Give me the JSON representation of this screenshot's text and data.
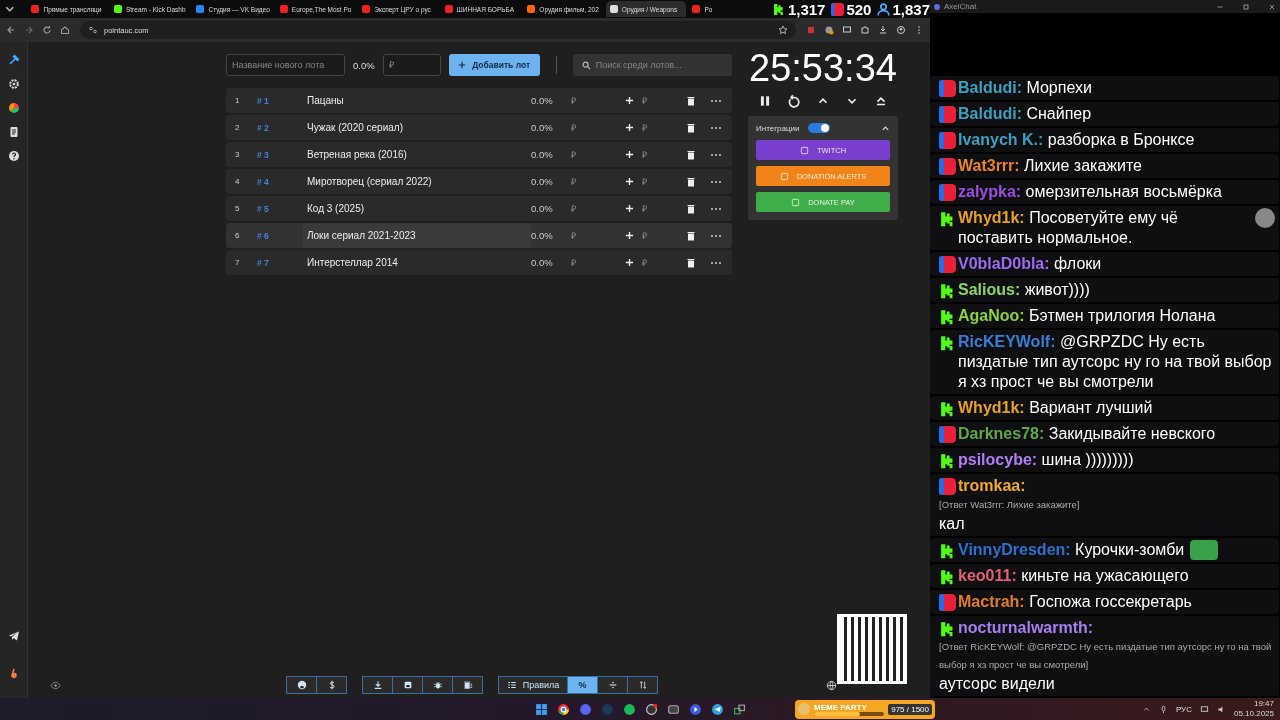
{
  "browser": {
    "tabs": [
      {
        "title": "Прямые трансляци",
        "kind": "youtube",
        "selected": false
      },
      {
        "title": "Stream - Kick Dashb",
        "kind": "kick",
        "selected": false
      },
      {
        "title": "Студия — VK Видео",
        "kind": "vk",
        "selected": false
      },
      {
        "title": "Europe,The Most Po",
        "kind": "youtube",
        "selected": false
      },
      {
        "title": "Эксперт ЦРУ о рус",
        "kind": "youtube",
        "selected": false
      },
      {
        "title": "ШИННАЯ БОРЬБА",
        "kind": "youtube",
        "selected": false
      },
      {
        "title": "Орудия фильм, 202",
        "kind": "kino",
        "selected": false
      },
      {
        "title": "Орудия / Weapons",
        "kind": "globe",
        "selected": true
      },
      {
        "title": "Po",
        "kind": "youtube",
        "selected": false
      }
    ],
    "address": "pointauc.com"
  },
  "stream_stats": [
    {
      "kind": "kick",
      "count": "1,317"
    },
    {
      "kind": "live",
      "count": "520"
    },
    {
      "kind": "viewers",
      "count": "1,837"
    }
  ],
  "auction": {
    "new_lot": {
      "placeholder": "Название нового лота"
    },
    "new_percent": "0.0%",
    "new_amount": {
      "placeholder": "₽"
    },
    "add_button": "Добавить лот",
    "search": {
      "placeholder": "Поиск среди лотов..."
    },
    "lots": [
      {
        "index": "1",
        "tag": "# 1",
        "name": "Пацаны",
        "percent": "0.0%",
        "amount": {
          "placeholder": "₽"
        },
        "add_amount": {
          "placeholder": "₽"
        },
        "highlighted": false
      },
      {
        "index": "2",
        "tag": "# 2",
        "name": "Чужак (2020 сериал)",
        "percent": "0.0%",
        "amount": {
          "placeholder": "₽"
        },
        "add_amount": {
          "placeholder": "₽"
        },
        "highlighted": false
      },
      {
        "index": "3",
        "tag": "# 3",
        "name": "Ветреная река (2016)",
        "percent": "0.0%",
        "amount": {
          "placeholder": "₽"
        },
        "add_amount": {
          "placeholder": "₽"
        },
        "highlighted": false
      },
      {
        "index": "4",
        "tag": "# 4",
        "name": "Миротворец (сериал 2022)",
        "percent": "0.0%",
        "amount": {
          "placeholder": "₽"
        },
        "add_amount": {
          "placeholder": "₽"
        },
        "highlighted": false
      },
      {
        "index": "5",
        "tag": "# 5",
        "name": "Код 3 (2025)",
        "percent": "0.0%",
        "amount": {
          "placeholder": "₽"
        },
        "add_amount": {
          "placeholder": "₽"
        },
        "highlighted": false
      },
      {
        "index": "6",
        "tag": "# 6",
        "name": "Локи сериал 2021-2023",
        "percent": "0.0%",
        "amount": {
          "placeholder": "₽"
        },
        "add_amount": {
          "placeholder": "₽"
        },
        "highlighted": true
      },
      {
        "index": "7",
        "tag": "# 7",
        "name": "Интерстеллар 2014",
        "percent": "0.0%",
        "amount": {
          "placeholder": "₽"
        },
        "add_amount": {
          "placeholder": "₽"
        },
        "highlighted": false
      }
    ],
    "timer": "25:53:34",
    "integrations": {
      "label": "Интеграции",
      "on": true,
      "expanded": true,
      "services": [
        {
          "label": "TWITCH",
          "color": "#7b3fd0"
        },
        {
          "label": "DONATION ALERTS",
          "color": "#f08418"
        },
        {
          "label": "DONATE PAY",
          "color": "#3fae4a"
        }
      ]
    },
    "toolbar": {
      "rules_button": "Правила",
      "percent_button": {
        "label": "%",
        "selected": true
      }
    }
  },
  "chat": {
    "title": "AxelChat",
    "messages": [
      {
        "kind": "live",
        "user": "Baldudi:",
        "color": "#3aa0c0",
        "text": "Морпехи"
      },
      {
        "kind": "live",
        "user": "Baldudi:",
        "color": "#3aa0c0",
        "text": "Снайпер"
      },
      {
        "kind": "live",
        "user": "Ivanych K.:",
        "color": "#3aa0c0",
        "text": "разборка в Бронксе"
      },
      {
        "kind": "live",
        "user": "Wat3rrr:",
        "color": "#e8832a",
        "text": "Лихие закажите"
      },
      {
        "kind": "live",
        "user": "zalypka:",
        "color": "#9b4de0",
        "text": "омерзительная восьмёрка"
      },
      {
        "kind": "kick",
        "user": "Whyd1k:",
        "color": "#e8a020",
        "text": "Посоветуйте ему чё поставить нормальное.",
        "emote": {
          "kind": "face"
        }
      },
      {
        "kind": "live",
        "user": "V0blaD0bla:",
        "color": "#9b6cf0",
        "text": "флоки"
      },
      {
        "kind": "kick",
        "user": "Salious:",
        "color": "#8ad46a",
        "text": "живот))))"
      },
      {
        "kind": "kick",
        "user": "AgaNoo:",
        "color": "#8ad040",
        "text": "Бэтмен трилогия Нолана"
      },
      {
        "kind": "kick",
        "user": "RicKEYWolf:",
        "color": "#3a7dd8",
        "text": "@GRPZDC Ну есть пиздатые тип аутсорс ну го на твой выбор я хз прост че вы смотрели"
      },
      {
        "kind": "kick",
        "user": "Whyd1k:",
        "color": "#e8a020",
        "text": "Вариант лучший"
      },
      {
        "kind": "live",
        "user": "Darknes78:",
        "color": "#5fa84a",
        "text": "Закидывайте невского"
      },
      {
        "kind": "kick",
        "user": "psilocybe:",
        "color": "#b07ef5",
        "text": "шина )))))))))"
      },
      {
        "kind": "live",
        "user": "tromkaa:",
        "color": "#f0a830",
        "reply": "[Ответ Wat3rrr: Лихие закажите]",
        "text": "кал"
      },
      {
        "kind": "kick",
        "user": "VinnyDresden:",
        "color": "#2f6fd0",
        "text": "Курочки-зомби",
        "emote": {
          "kind": "frog"
        }
      },
      {
        "kind": "kick",
        "user": "keo011:",
        "color": "#e06070",
        "text": "киньте на ужасающего"
      },
      {
        "kind": "live",
        "user": "Mactrah:",
        "color": "#e07a30",
        "text": "Госпожа госсекретарь"
      },
      {
        "kind": "kick",
        "user": "nocturnalwarmth:",
        "color": "#a77ef0",
        "reply": "[Ответ RicKEYWolf: @GRPZDC Ну есть пиздатые тип аутсорс ну го на твой выбор я хз прост че вы смотрели]",
        "text": "аутсорс видели"
      }
    ]
  },
  "taskbar": {
    "widget": {
      "title": "MEME PARTY",
      "count": "975 / 1500",
      "level": 0.65
    },
    "language": "РУС",
    "time": "19:47",
    "date": "05.10.2025"
  }
}
